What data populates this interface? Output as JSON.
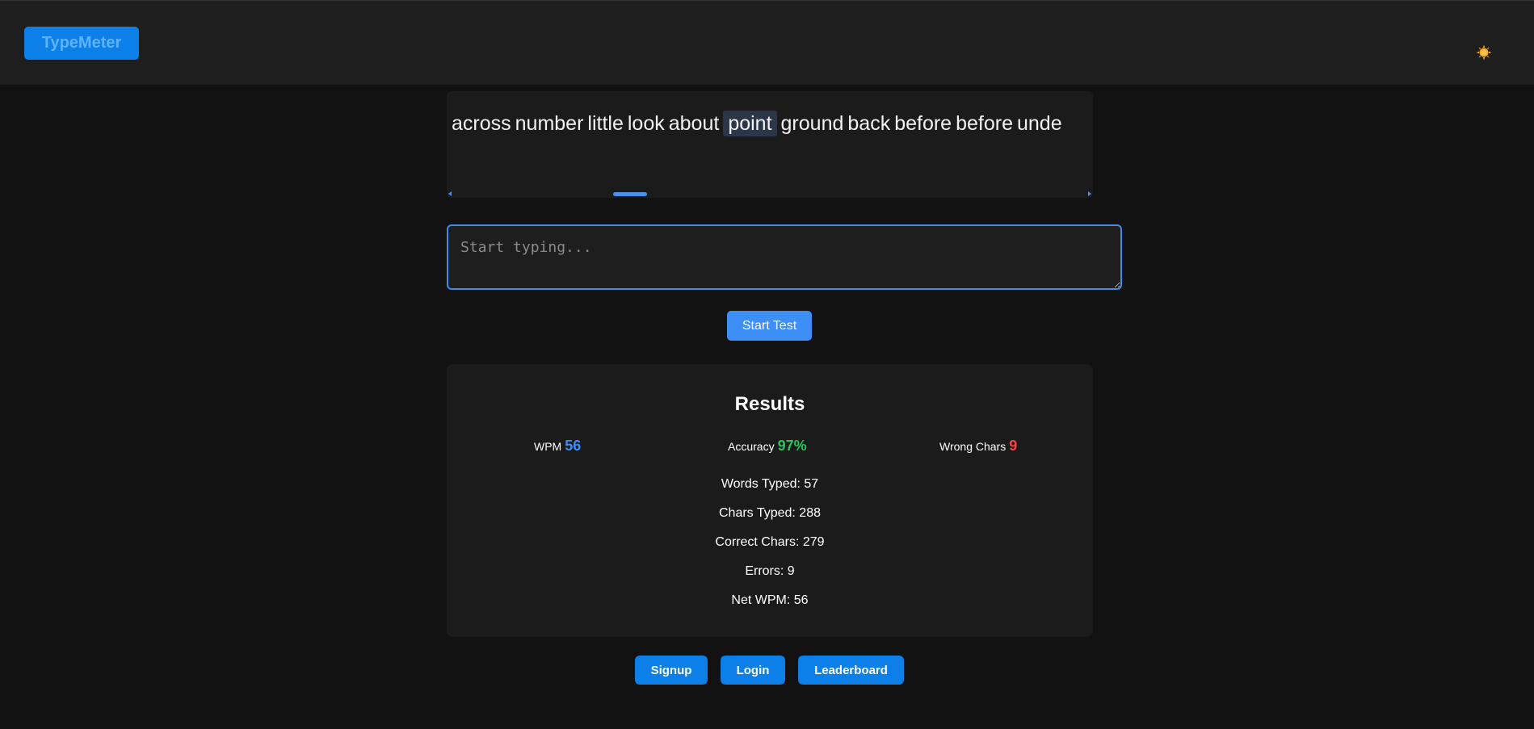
{
  "header": {
    "logo": "TypeMeter",
    "theme_icon": "sun-icon"
  },
  "text_display": {
    "words": [
      "across",
      "number",
      "little",
      "look",
      "about",
      "point",
      "ground",
      "back",
      "before",
      "before",
      "unde"
    ],
    "current_word_index": 5
  },
  "input": {
    "value": "",
    "placeholder": "Start typing..."
  },
  "start_button": {
    "label": "Start Test"
  },
  "results": {
    "title": "Results",
    "wpm_label": "WPM",
    "wpm_value": "56",
    "accuracy_label": "Accuracy",
    "accuracy_value": "97%",
    "wrong_label": "Wrong Chars",
    "wrong_value": "9",
    "words_typed": "Words Typed: 57",
    "chars_typed": "Chars Typed: 288",
    "correct_chars": "Correct Chars: 279",
    "errors": "Errors: 9",
    "net_wpm": "Net WPM: 56"
  },
  "nav": {
    "signup": "Signup",
    "login": "Login",
    "leaderboard": "Leaderboard"
  },
  "colors": {
    "accent": "#3d8ef5",
    "brand": "#0d7fe8",
    "success": "#22c55e",
    "error": "#ef4444",
    "sun": "#f5a623"
  }
}
